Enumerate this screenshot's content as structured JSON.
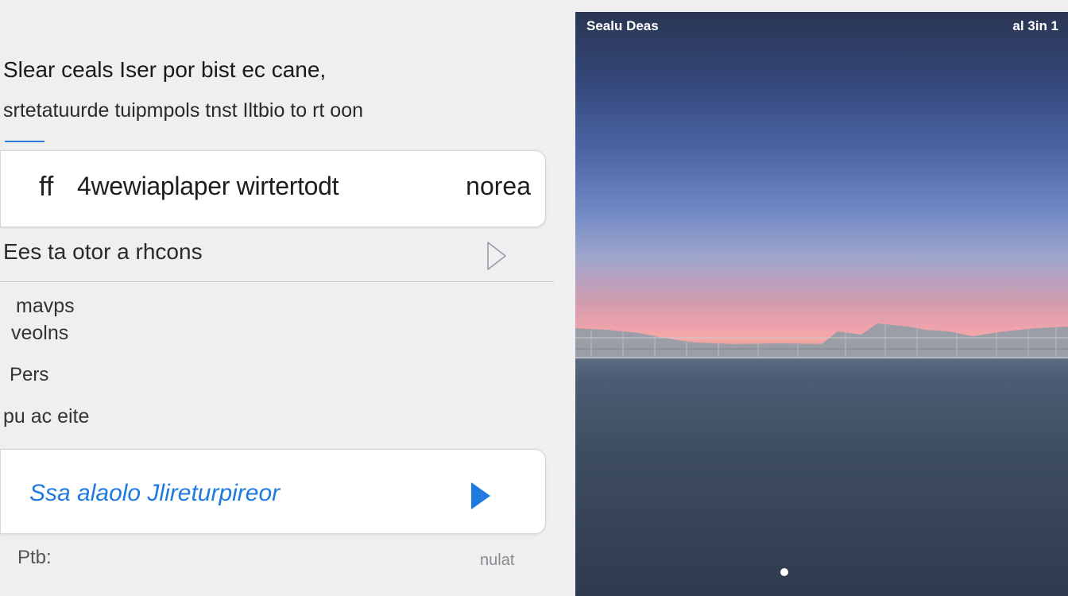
{
  "intro": {
    "line1": "Slear ceals  Iser por bist ec cane,",
    "line2": "srtetatuurde tuipmpols tnst Iltbio to rt oon"
  },
  "top_card": {
    "icon_symbol": "ff",
    "label": "4wewiaplaper wirtertodt",
    "value": "norea"
  },
  "main_row": {
    "label": "Ees ta otor a   rhcons"
  },
  "sub_items": [
    "mavps",
    "veolns",
    "Pers",
    "pu ac eite"
  ],
  "bottom_card": {
    "label": "Ssa alaolo Jlireturpireor"
  },
  "footer": {
    "left": "Ptb:",
    "right": "nulat"
  },
  "phone": {
    "status_left": "Sealu Deas",
    "status_right": "al 3in 1"
  },
  "colors": {
    "accent": "#1f7ae0",
    "background": "#efeff1",
    "card": "#ffffff"
  }
}
